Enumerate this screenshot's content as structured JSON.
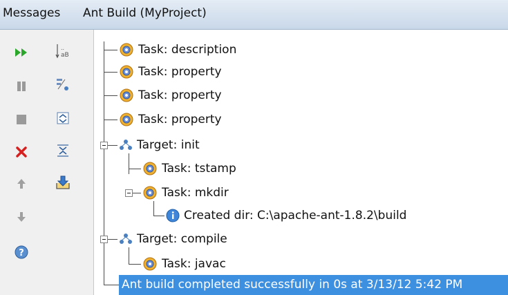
{
  "titlebar": {
    "messages_tab": "Messages",
    "build_tab": "Ant Build (MyProject)"
  },
  "toolbar": {
    "left": [
      "run-icon",
      "pause-icon",
      "stop-icon",
      "close-icon",
      "up-arrow-icon",
      "down-arrow-icon",
      "help-icon"
    ],
    "right": [
      "sort-az-icon",
      "filter-icon",
      "expand-all-icon",
      "collapse-all-icon",
      "export-icon"
    ]
  },
  "tree": {
    "rows": [
      "Task: description",
      "Task: property",
      "Task: property",
      "Task: property",
      "Target: init",
      "Task: tstamp",
      "Task: mkdir",
      "Created dir: C:\\apache-ant-1.8.2\\build",
      "Target: compile",
      "Task: javac"
    ],
    "status": "Ant build completed successfully in 0s at 3/13/12 5:42 PM"
  },
  "colors": {
    "selection": "#3d8fe0",
    "stop_red": "#d62020",
    "run_green": "#2aa62a"
  }
}
